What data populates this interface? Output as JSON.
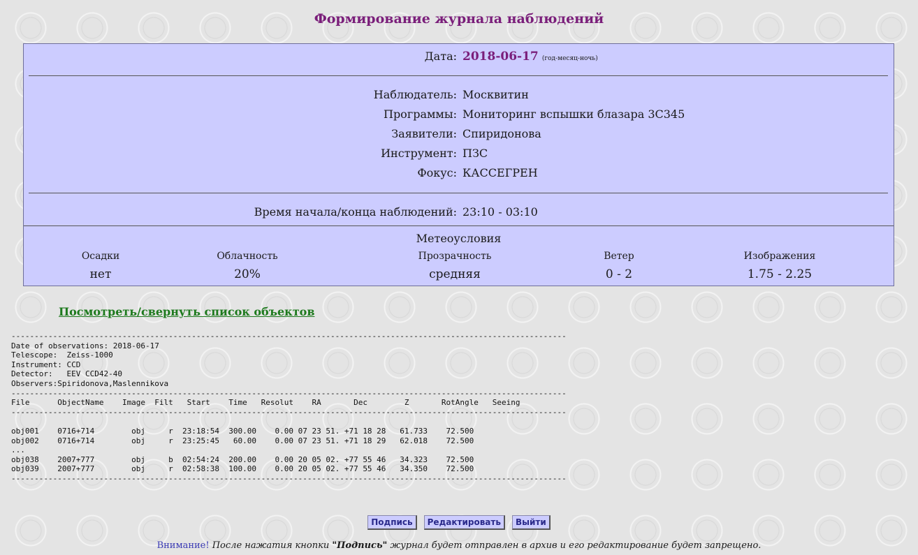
{
  "page": {
    "title": "Формирование журнала наблюдений"
  },
  "panel": {
    "date_label": "Дата:",
    "date_value": "2018-06-17",
    "date_note": "(год-месяц-ночь)",
    "fields": [
      {
        "label": "Наблюдатель:",
        "value": "Москвитин"
      },
      {
        "label": "Программы:",
        "value": "Мониторинг вспышки блазара 3C345"
      },
      {
        "label": "Заявители:",
        "value": "Спиридонова"
      },
      {
        "label": "Инструмент:",
        "value": "ПЗС"
      },
      {
        "label": "Фокус:",
        "value": "КАССЕГРЕН"
      }
    ],
    "time_label": "Время начала/конца наблюдений:",
    "time_value": "23:10 - 03:10"
  },
  "meteo": {
    "title": "Метеоусловия",
    "columns": [
      {
        "head": "Осадки",
        "value": "нет"
      },
      {
        "head": "Облачность",
        "value": "20%"
      },
      {
        "head": "Прозрачность",
        "value": "средняя"
      },
      {
        "head": "Ветер",
        "value": "0 - 2"
      },
      {
        "head": "Изображения",
        "value": "1.75 - 2.25"
      }
    ]
  },
  "toggle_link": "Посмотреть/свернуть список объектов",
  "log": {
    "lines": [
      "------------------------------------------------------------------------------------------------------------------------",
      "Date of observations: 2018-06-17",
      "Telescope:  Zeiss-1000",
      "Instrument: CCD",
      "Detector:   EEV CCD42-40",
      "Observers:Spiridonova,Maslennikova",
      "------------------------------------------------------------------------------------------------------------------------",
      "File      ObjectName    Image  Filt   Start    Time   Resolut    RA       Dec        Z       RotAngle   Seeing",
      "------------------------------------------------------------------------------------------------------------------------",
      "",
      "obj001    0716+714        obj     r  23:18:54  300.00    0.00 07 23 51. +71 18 28   61.733    72.500",
      "obj002    0716+714        obj     r  23:25:45   60.00    0.00 07 23 51. +71 18 29   62.018    72.500",
      "...",
      "obj038    2007+777        obj     b  02:54:24  200.00    0.00 20 05 02. +77 55 46   34.323    72.500",
      "obj039    2007+777        obj     r  02:58:38  100.00    0.00 20 05 02. +77 55 46   34.350    72.500",
      "------------------------------------------------------------------------------------------------------------------------"
    ]
  },
  "buttons": {
    "sign": "Подпись",
    "edit": "Редактировать",
    "exit": "Выйти"
  },
  "warning": {
    "word": "Внимание!",
    "text1": "После нажатия кнопки",
    "bold": "\"Подпись\"",
    "text2": "журнал будет отправлен в архив и его редактирование будет запрещено."
  }
}
